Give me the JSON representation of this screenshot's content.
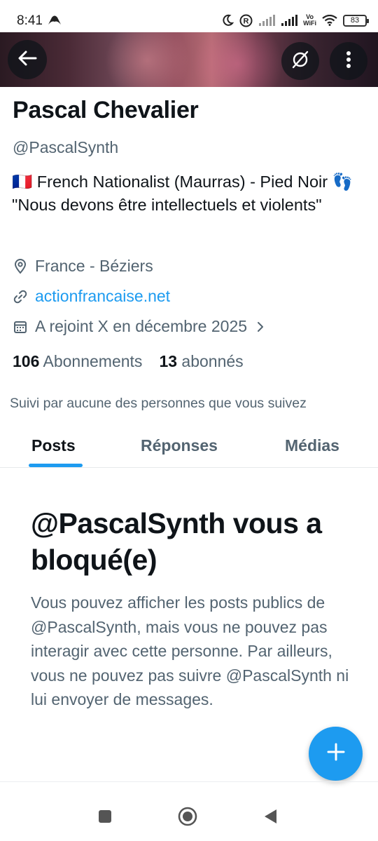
{
  "status_bar": {
    "time": "8:41",
    "battery": "83",
    "vowifi": "Vo\nWiFi",
    "icons": [
      "app-notification-icon",
      "moon-icon",
      "registered-icon",
      "signal-icon",
      "signal-icon",
      "wifi-icon",
      "battery-icon"
    ]
  },
  "banner": {
    "colors": [
      "#2a1a22",
      "#94505f",
      "#b56b74",
      "#201520"
    ]
  },
  "header_buttons": {
    "back": "back-arrow-icon",
    "verify": "no-verification-icon",
    "more": "more-vertical-icon"
  },
  "profile": {
    "name": "Pascal Chevalier",
    "handle": "@PascalSynth",
    "bio": "🇫🇷 French Nationalist (Maurras) - Pied Noir 👣 \"Nous devons être intellectuels et violents\"",
    "location": "France - Béziers",
    "website": "actionfrancaise.net",
    "joined": "A rejoint X en décembre 2025",
    "following_count": "106",
    "following_label": "Abonnements",
    "followers_count": "13",
    "followers_label": "abonnés",
    "followed_by": "Suivi par aucune des personnes que vous suivez"
  },
  "tabs": {
    "posts": "Posts",
    "replies": "Réponses",
    "media": "Médias",
    "active": "Posts"
  },
  "blocked": {
    "title": "@PascalSynth vous a bloqué(e)",
    "body": "Vous pouvez afficher les posts publics de @PascalSynth, mais vous ne pouvez pas interagir avec cette personne. Par ailleurs, vous ne pouvez pas suivre @PascalSynth ni lui envoyer de messages."
  },
  "fab": {
    "icon": "plus-icon"
  },
  "nav": {
    "recent": "recent-apps-icon",
    "home": "home-icon",
    "back": "back-triangle-icon"
  },
  "colors": {
    "accent": "#1d9bf0",
    "text_primary": "#0f1419",
    "text_secondary": "#536471"
  }
}
